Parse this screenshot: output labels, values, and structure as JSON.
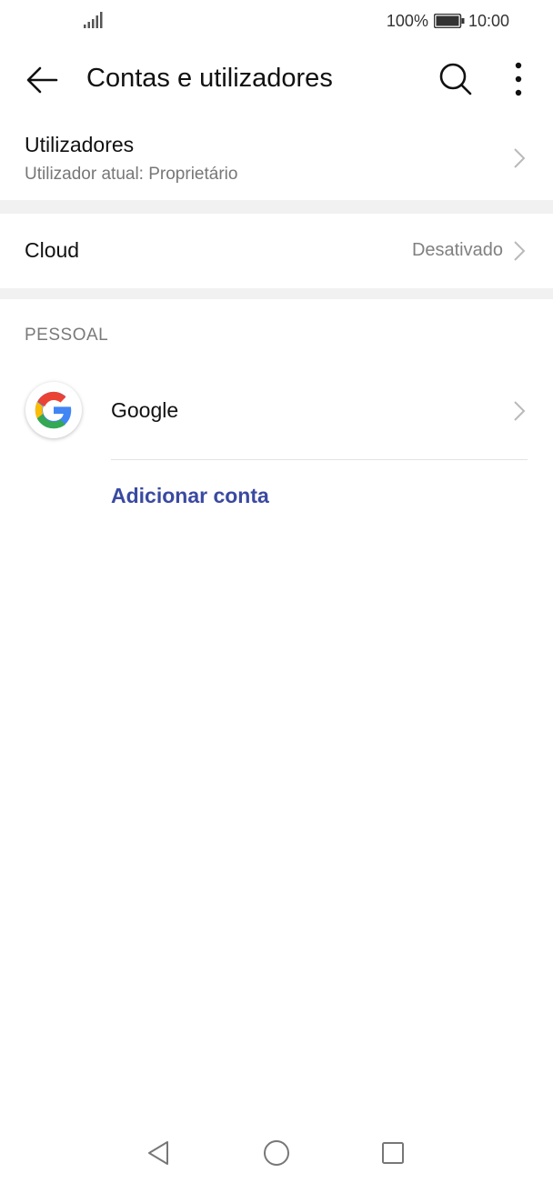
{
  "status_bar": {
    "battery": "100%",
    "time": "10:00",
    "icons": [
      "signal-icon",
      "battery-icon"
    ]
  },
  "app_bar": {
    "title": "Contas e utilizadores",
    "icons": [
      "back-arrow-icon",
      "search-icon",
      "more-vert-icon"
    ]
  },
  "users_row": {
    "title": "Utilizadores",
    "subtitle": "Utilizador atual: Proprietário"
  },
  "cloud_row": {
    "title": "Cloud",
    "value": "Desativado"
  },
  "personal_section": {
    "header": "PESSOAL",
    "accounts": [
      {
        "label": "Google",
        "icon": "google-logo-icon"
      }
    ],
    "add_account_label": "Adicionar conta"
  },
  "nav_bar": {
    "icons": [
      "back-triangle-icon",
      "home-circle-icon",
      "recents-square-icon"
    ]
  },
  "colors": {
    "accent": "#3a4aa1",
    "secondary_text": "#777777",
    "divider_band": "#f1f1f1"
  }
}
